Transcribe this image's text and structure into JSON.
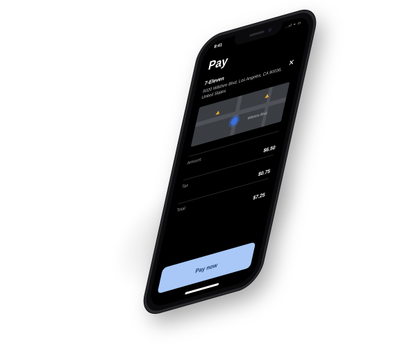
{
  "status_bar": {
    "time": "9:41",
    "icons": "..ıl ≈ ▭"
  },
  "header": {
    "title": "Pay",
    "close_symbol": "✕"
  },
  "merchant": {
    "name": "7-Eleven",
    "address": "6020 Wilshire Blvd, Los Angeles, CA 90036, United States"
  },
  "map": {
    "label": "Wilshire Blvd"
  },
  "summary": {
    "rows": [
      {
        "label": "Amount",
        "value": "$6.50"
      },
      {
        "label": "Tax",
        "value": "$0.75"
      },
      {
        "label": "Total",
        "value": "$7.25"
      }
    ]
  },
  "actions": {
    "pay_label": "Pay now"
  },
  "colors": {
    "screen_background": "#000000",
    "pay_button_background": "#a9c8f7",
    "pay_button_text": "#1f3a6a",
    "location_dot": "#3b6fe0",
    "map_pin": "#e7a431"
  }
}
